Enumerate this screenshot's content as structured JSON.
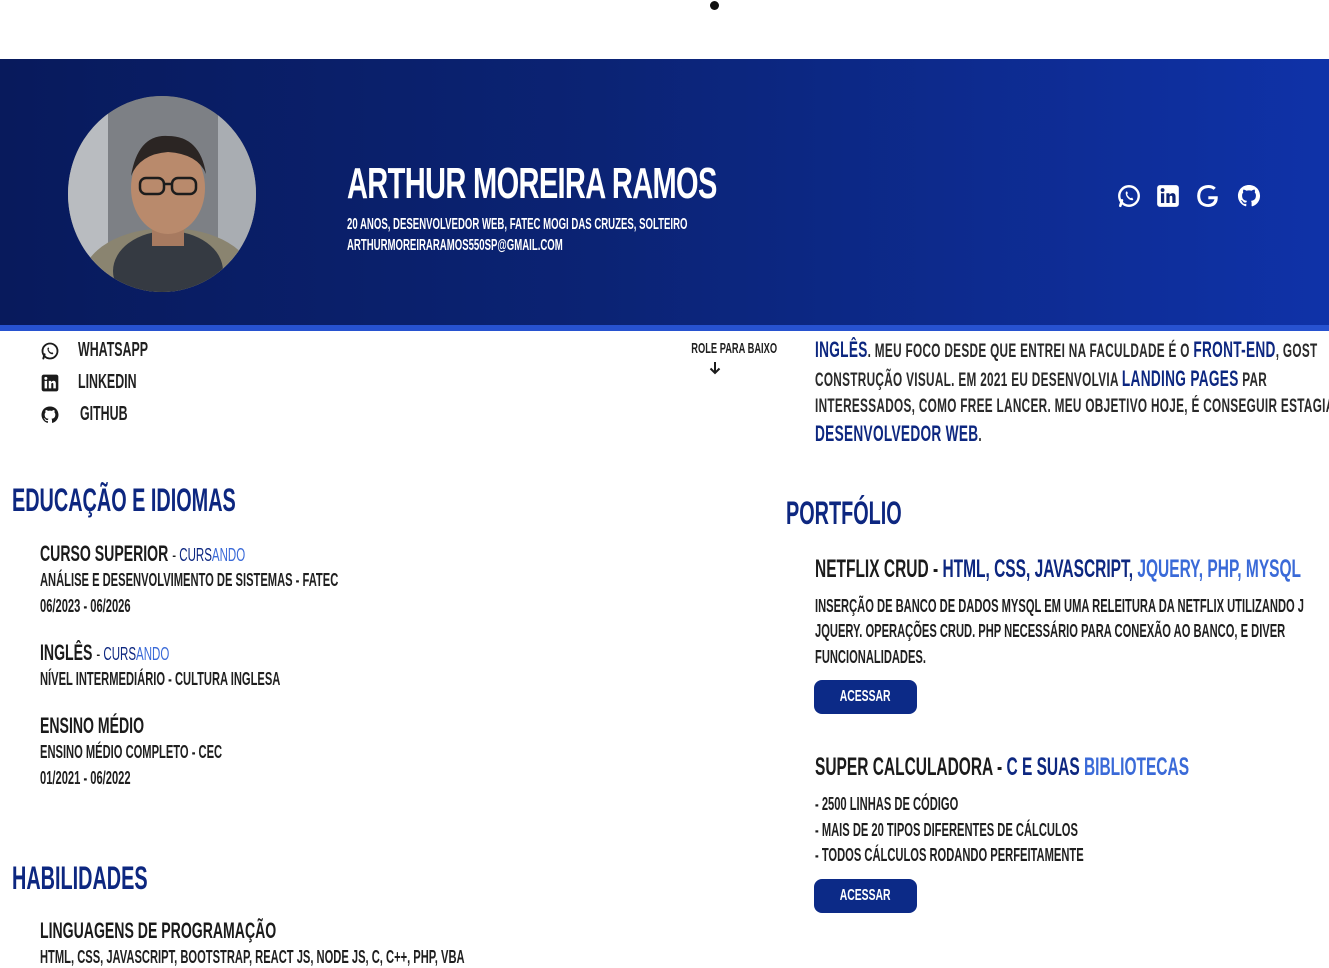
{
  "header": {
    "name": "ARTHUR MOREIRA RAMOS",
    "subtitle": "20 ANOS, DESENVOLVEDOR WEB, FATEC MOGI DAS CRUZES, SOLTEIRO",
    "email": "ARTHURMOREIRARAMOS550SP@GMAIL.COM",
    "social_icons": [
      "whatsapp-icon",
      "linkedin-icon",
      "google-icon",
      "github-icon"
    ],
    "colors": {
      "header_start": "#081a5c",
      "header_end": "#0f32a8",
      "accent_line": "#2752d0"
    }
  },
  "contacts": [
    {
      "label": "WHATSAPP",
      "icon": "whatsapp-icon"
    },
    {
      "label": "LINKEDIN",
      "icon": "linkedin-icon"
    },
    {
      "label": "GITHUB",
      "icon": "github-icon"
    }
  ],
  "scroll_hint": "ROLE PARA BAIXO",
  "education": {
    "title": "EDUCAÇÃO E IDIOMAS",
    "items": [
      {
        "title": "CURSO SUPERIOR",
        "status_prefix": "- ",
        "status_dark": "CURS",
        "status_light": "ANDO",
        "lines": [
          "ANÁLISE E DESENVOLVIMENTO DE SISTEMAS - FATEC",
          "06/2023 - 06/2026"
        ]
      },
      {
        "title": "INGLÊS",
        "status_prefix": "- ",
        "status_dark": "CURS",
        "status_light": "ANDO",
        "lines": [
          "NÍVEL INTERMEDIÁRIO - CULTURA INGLESA"
        ]
      },
      {
        "title": "ENSINO MÉDIO",
        "lines": [
          "ENSINO MÉDIO COMPLETO - CEC",
          "01/2021 - 06/2022"
        ]
      }
    ]
  },
  "skills": {
    "title": "HABILIDADES",
    "items": [
      {
        "title": "LINGUAGENS DE PROGRAMAÇÃO",
        "line": "HTML, CSS, JAVASCRIPT, BOOTSTRAP, REACT JS, NODE JS, C, C++, PHP, VBA"
      }
    ]
  },
  "about": {
    "line1": {
      "a": "INGLÊS",
      "b": ". MEU FOCO DESDE QUE ENTREI NA FACULDADE É O ",
      "c": "FRONT-END",
      "d": ", GOST"
    },
    "line2": {
      "a": "CONSTRUÇÃO VISUAL. EM 2021 EU DESENVOLVIA ",
      "b": "LANDING PAGES",
      "c": " PAR"
    },
    "line3": "INTERESSADOS, COMO FREE LANCER. MEU OBJETIVO HOJE, É CONSEGUIR ESTAGIA",
    "line4": {
      "a": "DESENVOLVEDOR WEB",
      "b": "."
    }
  },
  "portfolio": {
    "title": "PORTFÓLIO",
    "projects": [
      {
        "name": "NETFLIX CRUD",
        "sep": " - ",
        "tech_dark": "HTML, CSS, JAVASCRIPT,",
        "tech_light": " JQUERY, PHP, MYSQL",
        "desc": [
          "INSERÇÃO DE BANCO DE DADOS MYSQL EM UMA RELEITURA DA NETFLIX UTILIZANDO J",
          "JQUERY. OPERAÇÕES CRUD. PHP NECESSÁRIO PARA CONEXÃO AO BANCO, E DIVER",
          "FUNCIONALIDADES."
        ],
        "button": "ACESSAR"
      },
      {
        "name": "SUPER CALCULADORA",
        "sep": " - ",
        "tech_dark": "C E SUAS ",
        "tech_light": "BIBLIOTECAS",
        "desc": [
          "- 2500 LINHAS DE CÓDIGO",
          "- MAIS DE 20 TIPOS DIFERENTES DE CÁLCULOS",
          "- TODOS CÁLCULOS RODANDO PERFEITAMENTE"
        ],
        "button": "ACESSAR"
      }
    ]
  }
}
